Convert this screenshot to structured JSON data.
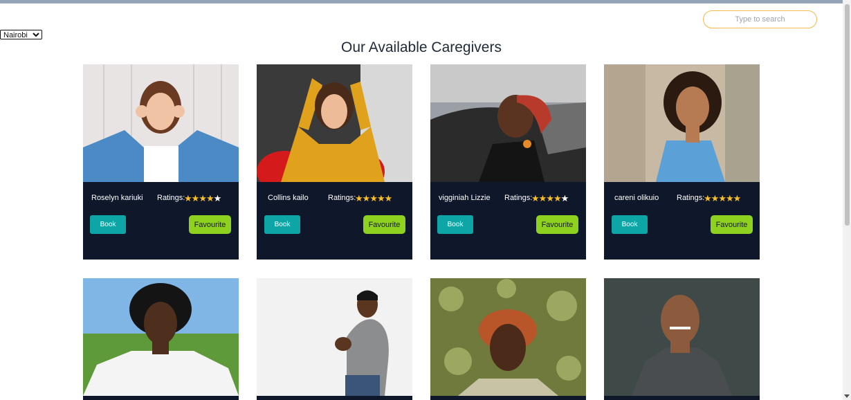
{
  "search": {
    "placeholder": "Type to search"
  },
  "location": {
    "selected": "Nairobi"
  },
  "page_title": "Our Available Caregivers",
  "labels": {
    "ratings": "Ratings:",
    "book": "Book",
    "favourite": "Favourite"
  },
  "colors": {
    "card_bg": "#0f172a",
    "book_button": "#0ea5a6",
    "favourite_button": "#8fd11f",
    "star": "#fbbf24",
    "search_border": "#f3b94d"
  },
  "caregivers": [
    {
      "name": "Roselyn kariuki",
      "rating": 4
    },
    {
      "name": "Collins kailo",
      "rating": 5
    },
    {
      "name": "vigginiah Lizzie",
      "rating": 4
    },
    {
      "name": "careni olikuio",
      "rating": 5
    },
    {
      "name": "",
      "rating": null
    },
    {
      "name": "",
      "rating": null
    },
    {
      "name": "",
      "rating": null
    },
    {
      "name": "",
      "rating": null
    }
  ]
}
